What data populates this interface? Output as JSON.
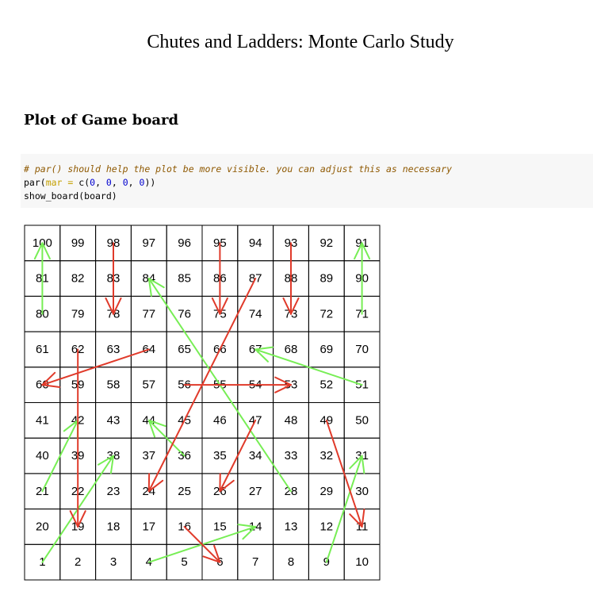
{
  "document": {
    "title": "Chutes and Ladders: Monte Carlo Study",
    "section_heading": "Plot of Game board"
  },
  "code": {
    "comment": "# par() should help the plot be more visible. you can adjust this as necessary",
    "line2": {
      "fn": "par(",
      "arg": "mar",
      "eq": " = ",
      "c": "c(",
      "n1": "0",
      "n2": "0",
      "n3": "0",
      "n4": "0",
      "close": "))"
    },
    "line3": "show_board(board)"
  },
  "board": {
    "rows": 10,
    "cols": 10,
    "cells": [
      [
        100,
        99,
        98,
        97,
        96,
        95,
        94,
        93,
        92,
        91
      ],
      [
        81,
        82,
        83,
        84,
        85,
        86,
        87,
        88,
        89,
        90
      ],
      [
        80,
        79,
        78,
        77,
        76,
        75,
        74,
        73,
        72,
        71
      ],
      [
        61,
        62,
        63,
        64,
        65,
        66,
        67,
        68,
        69,
        70
      ],
      [
        60,
        59,
        58,
        57,
        56,
        55,
        54,
        53,
        52,
        51
      ],
      [
        41,
        42,
        43,
        44,
        45,
        46,
        47,
        48,
        49,
        50
      ],
      [
        40,
        39,
        38,
        37,
        36,
        35,
        34,
        33,
        32,
        31
      ],
      [
        21,
        22,
        23,
        24,
        25,
        26,
        27,
        28,
        29,
        30
      ],
      [
        20,
        19,
        18,
        17,
        16,
        15,
        14,
        13,
        12,
        11
      ],
      [
        1,
        2,
        3,
        4,
        5,
        6,
        7,
        8,
        9,
        10
      ]
    ],
    "colors": {
      "ladder": "#77ee55",
      "chute": "#e03a2a",
      "grid": "#000000"
    },
    "ladders": [
      {
        "from": 1,
        "to": 38
      },
      {
        "from": 4,
        "to": 14
      },
      {
        "from": 9,
        "to": 31
      },
      {
        "from": 21,
        "to": 42
      },
      {
        "from": 28,
        "to": 84
      },
      {
        "from": 36,
        "to": 44
      },
      {
        "from": 51,
        "to": 67
      },
      {
        "from": 71,
        "to": 91
      },
      {
        "from": 80,
        "to": 100
      }
    ],
    "chutes": [
      {
        "from": 16,
        "to": 6
      },
      {
        "from": 47,
        "to": 26
      },
      {
        "from": 49,
        "to": 11
      },
      {
        "from": 56,
        "to": 53
      },
      {
        "from": 62,
        "to": 19
      },
      {
        "from": 64,
        "to": 60
      },
      {
        "from": 87,
        "to": 24
      },
      {
        "from": 93,
        "to": 73
      },
      {
        "from": 95,
        "to": 75
      },
      {
        "from": 98,
        "to": 78
      }
    ]
  }
}
